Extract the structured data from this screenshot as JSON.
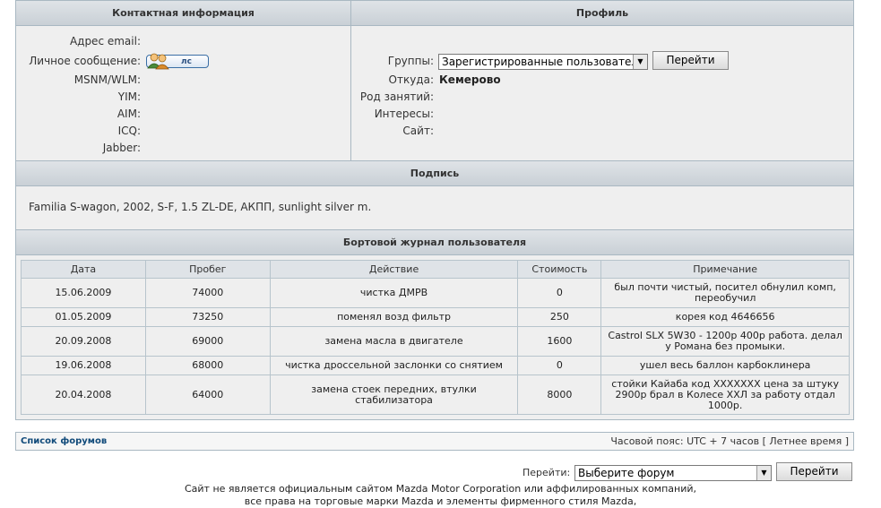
{
  "contact": {
    "header": "Контактная информация",
    "labels": [
      "Адрес email:",
      "Личное сообщение:",
      "MSNM/WLM:",
      "YIM:",
      "AIM:",
      "ICQ:",
      "Jabber:"
    ],
    "pm_button": "лс"
  },
  "profile": {
    "header": "Профиль",
    "groups_label": "Группы:",
    "groups_selected": "Зарегистрированные пользователи",
    "go_button": "Перейти",
    "location_label": "Откуда:",
    "location_value": "Кемерово",
    "occupation_label": "Род занятий:",
    "interests_label": "Интересы:",
    "site_label": "Сайт:"
  },
  "signature": {
    "header": "Подпись",
    "text": "Familia S-wagon, 2002, S-F, 1.5 ZL-DE, АКПП, sunlight silver m."
  },
  "logbook": {
    "header": "Бортовой журнал пользователя",
    "columns": [
      "Дата",
      "Пробег",
      "Действие",
      "Стоимость",
      "Примечание"
    ],
    "rows": [
      [
        "15.06.2009",
        "74000",
        "чистка ДМРВ",
        "0",
        "был почти чистый, посител обнулил комп, переобучил"
      ],
      [
        "01.05.2009",
        "73250",
        "поменял возд фильтр",
        "250",
        "корея код 4646656"
      ],
      [
        "20.09.2008",
        "69000",
        "замена масла в двигателе",
        "1600",
        "Castrol SLX 5W30 - 1200р 400р работа. делал у Романа без промыки."
      ],
      [
        "19.06.2008",
        "68000",
        "чистка дроссельной заслонки со снятием",
        "0",
        "ушел весь баллон карбоклинера"
      ],
      [
        "20.04.2008",
        "64000",
        "замена стоек передних, втулки стабилизатора",
        "8000",
        "стойки Кайаба код XXXXXXX цена за штуку 2900р брал в Колесе ХХЛ за работу отдал 1000р."
      ]
    ]
  },
  "footer": {
    "forum_list": "Список форумов",
    "timezone": "Часовой пояс: UTC + 7 часов [ Летнее время ]",
    "goto_label": "Перейти:",
    "goto_select": "Выберите форум",
    "goto_button": "Перейти",
    "disclaimer_1": "Сайт не является официальным сайтом Mazda Motor Corporation или аффилированных компаний,",
    "disclaimer_2": "все права на торговые марки Mazda и элементы фирменного стиля Mazda,"
  }
}
